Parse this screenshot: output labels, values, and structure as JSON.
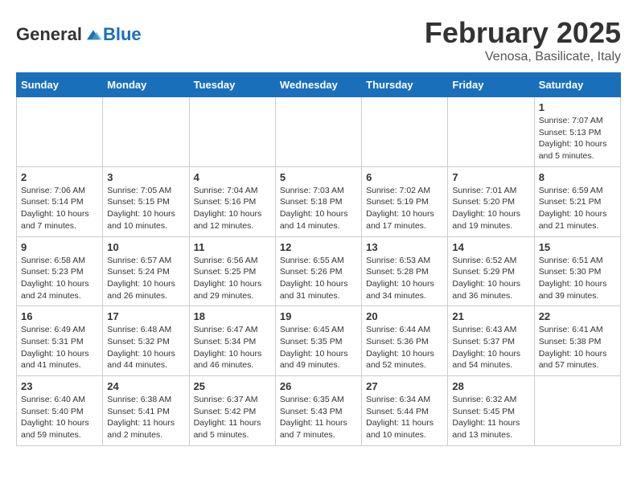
{
  "header": {
    "logo_general": "General",
    "logo_blue": "Blue",
    "month_title": "February 2025",
    "location": "Venosa, Basilicate, Italy"
  },
  "weekdays": [
    "Sunday",
    "Monday",
    "Tuesday",
    "Wednesday",
    "Thursday",
    "Friday",
    "Saturday"
  ],
  "weeks": [
    [
      {
        "day": "",
        "info": ""
      },
      {
        "day": "",
        "info": ""
      },
      {
        "day": "",
        "info": ""
      },
      {
        "day": "",
        "info": ""
      },
      {
        "day": "",
        "info": ""
      },
      {
        "day": "",
        "info": ""
      },
      {
        "day": "1",
        "info": "Sunrise: 7:07 AM\nSunset: 5:13 PM\nDaylight: 10 hours\nand 5 minutes."
      }
    ],
    [
      {
        "day": "2",
        "info": "Sunrise: 7:06 AM\nSunset: 5:14 PM\nDaylight: 10 hours\nand 7 minutes."
      },
      {
        "day": "3",
        "info": "Sunrise: 7:05 AM\nSunset: 5:15 PM\nDaylight: 10 hours\nand 10 minutes."
      },
      {
        "day": "4",
        "info": "Sunrise: 7:04 AM\nSunset: 5:16 PM\nDaylight: 10 hours\nand 12 minutes."
      },
      {
        "day": "5",
        "info": "Sunrise: 7:03 AM\nSunset: 5:18 PM\nDaylight: 10 hours\nand 14 minutes."
      },
      {
        "day": "6",
        "info": "Sunrise: 7:02 AM\nSunset: 5:19 PM\nDaylight: 10 hours\nand 17 minutes."
      },
      {
        "day": "7",
        "info": "Sunrise: 7:01 AM\nSunset: 5:20 PM\nDaylight: 10 hours\nand 19 minutes."
      },
      {
        "day": "8",
        "info": "Sunrise: 6:59 AM\nSunset: 5:21 PM\nDaylight: 10 hours\nand 21 minutes."
      }
    ],
    [
      {
        "day": "9",
        "info": "Sunrise: 6:58 AM\nSunset: 5:23 PM\nDaylight: 10 hours\nand 24 minutes."
      },
      {
        "day": "10",
        "info": "Sunrise: 6:57 AM\nSunset: 5:24 PM\nDaylight: 10 hours\nand 26 minutes."
      },
      {
        "day": "11",
        "info": "Sunrise: 6:56 AM\nSunset: 5:25 PM\nDaylight: 10 hours\nand 29 minutes."
      },
      {
        "day": "12",
        "info": "Sunrise: 6:55 AM\nSunset: 5:26 PM\nDaylight: 10 hours\nand 31 minutes."
      },
      {
        "day": "13",
        "info": "Sunrise: 6:53 AM\nSunset: 5:28 PM\nDaylight: 10 hours\nand 34 minutes."
      },
      {
        "day": "14",
        "info": "Sunrise: 6:52 AM\nSunset: 5:29 PM\nDaylight: 10 hours\nand 36 minutes."
      },
      {
        "day": "15",
        "info": "Sunrise: 6:51 AM\nSunset: 5:30 PM\nDaylight: 10 hours\nand 39 minutes."
      }
    ],
    [
      {
        "day": "16",
        "info": "Sunrise: 6:49 AM\nSunset: 5:31 PM\nDaylight: 10 hours\nand 41 minutes."
      },
      {
        "day": "17",
        "info": "Sunrise: 6:48 AM\nSunset: 5:32 PM\nDaylight: 10 hours\nand 44 minutes."
      },
      {
        "day": "18",
        "info": "Sunrise: 6:47 AM\nSunset: 5:34 PM\nDaylight: 10 hours\nand 46 minutes."
      },
      {
        "day": "19",
        "info": "Sunrise: 6:45 AM\nSunset: 5:35 PM\nDaylight: 10 hours\nand 49 minutes."
      },
      {
        "day": "20",
        "info": "Sunrise: 6:44 AM\nSunset: 5:36 PM\nDaylight: 10 hours\nand 52 minutes."
      },
      {
        "day": "21",
        "info": "Sunrise: 6:43 AM\nSunset: 5:37 PM\nDaylight: 10 hours\nand 54 minutes."
      },
      {
        "day": "22",
        "info": "Sunrise: 6:41 AM\nSunset: 5:38 PM\nDaylight: 10 hours\nand 57 minutes."
      }
    ],
    [
      {
        "day": "23",
        "info": "Sunrise: 6:40 AM\nSunset: 5:40 PM\nDaylight: 10 hours\nand 59 minutes."
      },
      {
        "day": "24",
        "info": "Sunrise: 6:38 AM\nSunset: 5:41 PM\nDaylight: 11 hours\nand 2 minutes."
      },
      {
        "day": "25",
        "info": "Sunrise: 6:37 AM\nSunset: 5:42 PM\nDaylight: 11 hours\nand 5 minutes."
      },
      {
        "day": "26",
        "info": "Sunrise: 6:35 AM\nSunset: 5:43 PM\nDaylight: 11 hours\nand 7 minutes."
      },
      {
        "day": "27",
        "info": "Sunrise: 6:34 AM\nSunset: 5:44 PM\nDaylight: 11 hours\nand 10 minutes."
      },
      {
        "day": "28",
        "info": "Sunrise: 6:32 AM\nSunset: 5:45 PM\nDaylight: 11 hours\nand 13 minutes."
      },
      {
        "day": "",
        "info": ""
      }
    ]
  ]
}
